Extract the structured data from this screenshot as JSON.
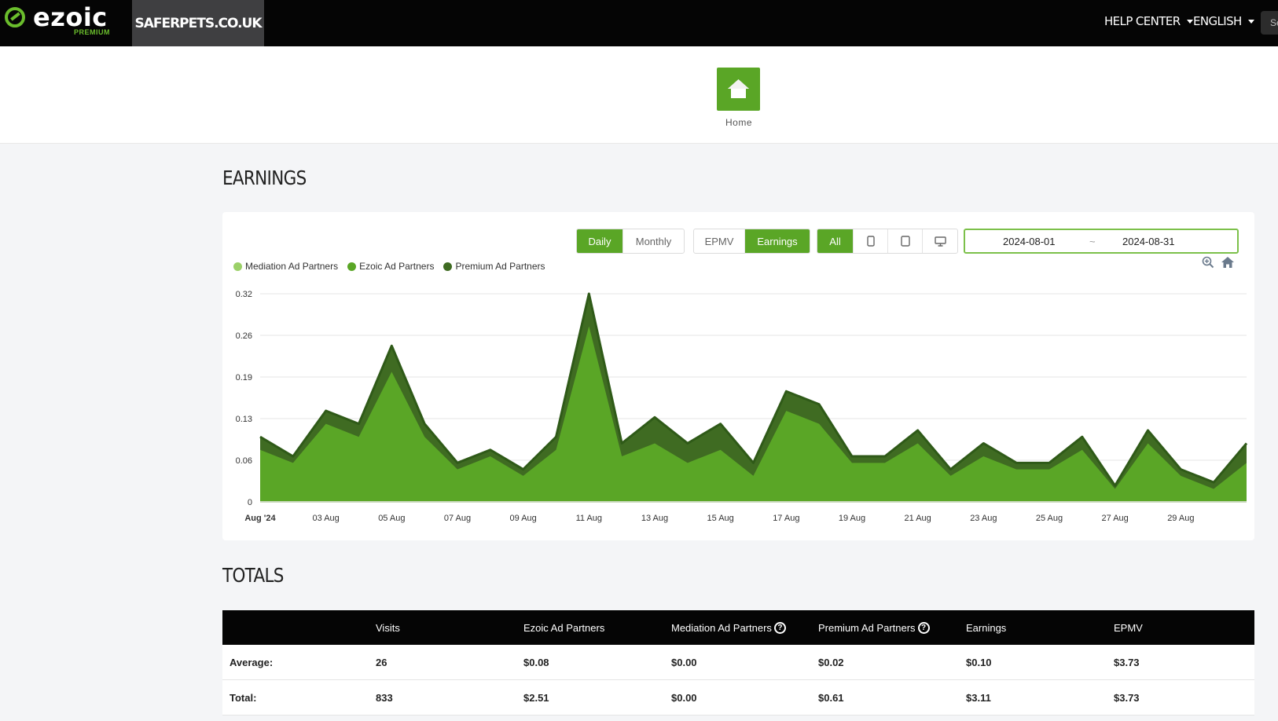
{
  "header": {
    "logo_text": "ezoic",
    "logo_sub": "PREMIUM",
    "site": "SAFERPETS.CO.UK",
    "help_center": "HELP CENTER",
    "language": "ENGLISH",
    "search_stub": "Se"
  },
  "home": {
    "label": "Home"
  },
  "earnings": {
    "title": "EARNINGS",
    "period_buttons": [
      "Daily",
      "Monthly"
    ],
    "metric_buttons": [
      "EPMV",
      "Earnings"
    ],
    "device_all": "All",
    "date_from": "2024-08-01",
    "date_sep": "~",
    "date_to": "2024-08-31"
  },
  "colors": {
    "brand_green": "#5aa626",
    "mediation": "#9bd068",
    "ezoic": "#5aa626",
    "premium": "#3f6b22"
  },
  "chart_data": {
    "type": "area",
    "stacked": true,
    "legend": [
      "Mediation Ad Partners",
      "Ezoic Ad Partners",
      "Premium Ad Partners"
    ],
    "legend_position": "top-left",
    "x": [
      "2024-08-01",
      "2024-08-02",
      "2024-08-03",
      "2024-08-04",
      "2024-08-05",
      "2024-08-06",
      "2024-08-07",
      "2024-08-08",
      "2024-08-09",
      "2024-08-10",
      "2024-08-11",
      "2024-08-12",
      "2024-08-13",
      "2024-08-14",
      "2024-08-15",
      "2024-08-16",
      "2024-08-17",
      "2024-08-18",
      "2024-08-19",
      "2024-08-20",
      "2024-08-21",
      "2024-08-22",
      "2024-08-23",
      "2024-08-24",
      "2024-08-25",
      "2024-08-26",
      "2024-08-27",
      "2024-08-28",
      "2024-08-29",
      "2024-08-30",
      "2024-08-31"
    ],
    "x_tick_labels": [
      "Aug '24",
      "03 Aug",
      "05 Aug",
      "07 Aug",
      "09 Aug",
      "11 Aug",
      "13 Aug",
      "15 Aug",
      "17 Aug",
      "19 Aug",
      "21 Aug",
      "23 Aug",
      "25 Aug",
      "27 Aug",
      "29 Aug"
    ],
    "y_tick_labels": [
      "0",
      "0.06",
      "0.13",
      "0.19",
      "0.26",
      "0.32"
    ],
    "ylim": [
      0,
      0.32
    ],
    "grid": true,
    "series": [
      {
        "name": "Mediation Ad Partners",
        "values": [
          0,
          0,
          0,
          0,
          0,
          0,
          0,
          0,
          0,
          0,
          0,
          0,
          0,
          0,
          0,
          0,
          0,
          0,
          0,
          0,
          0,
          0,
          0,
          0,
          0,
          0,
          0,
          0,
          0,
          0,
          0
        ]
      },
      {
        "name": "Ezoic Ad Partners",
        "values": [
          0.08,
          0.06,
          0.12,
          0.1,
          0.2,
          0.1,
          0.05,
          0.07,
          0.04,
          0.08,
          0.27,
          0.07,
          0.09,
          0.06,
          0.08,
          0.04,
          0.14,
          0.12,
          0.06,
          0.06,
          0.09,
          0.04,
          0.07,
          0.05,
          0.05,
          0.08,
          0.02,
          0.09,
          0.04,
          0.02,
          0.06
        ]
      },
      {
        "name": "Premium Ad Partners",
        "values": [
          0.02,
          0.01,
          0.02,
          0.02,
          0.04,
          0.02,
          0.01,
          0.01,
          0.01,
          0.02,
          0.05,
          0.02,
          0.04,
          0.03,
          0.04,
          0.02,
          0.03,
          0.03,
          0.01,
          0.01,
          0.02,
          0.01,
          0.02,
          0.01,
          0.01,
          0.02,
          0.005,
          0.02,
          0.01,
          0.01,
          0.03
        ]
      }
    ]
  },
  "totals": {
    "title": "TOTALS",
    "columns": [
      "",
      "Visits",
      "Ezoic Ad Partners",
      "Mediation Ad Partners",
      "Premium Ad Partners",
      "Earnings",
      "EPMV"
    ],
    "rows": [
      [
        "Average:",
        "26",
        "$0.08",
        "$0.00",
        "$0.02",
        "$0.10",
        "$3.73"
      ],
      [
        "Total:",
        "833",
        "$2.51",
        "$0.00",
        "$0.61",
        "$3.11",
        "$3.73"
      ]
    ]
  }
}
